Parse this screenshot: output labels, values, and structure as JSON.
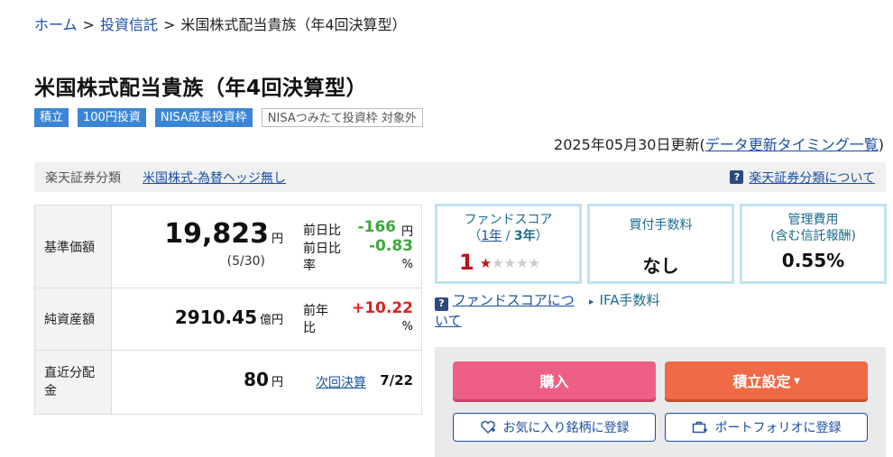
{
  "breadcrumb": {
    "home": "ホーム",
    "sep": ">",
    "funds": "投資信託",
    "current": "米国株式配当貴族（年4回決算型）"
  },
  "title": "米国株式配当貴族（年4回決算型）",
  "tags": {
    "tsumitate": "積立",
    "yen100": "100円投資",
    "nisa_growth": "NISA成長投資枠",
    "nisa_tsumitate": "NISAつみたて投資枠 対象外"
  },
  "updated": {
    "date_text": "2025年05月30日更新",
    "paren_open": "(",
    "link": "データ更新タイミング一覧",
    "paren_close": ")"
  },
  "category": {
    "label": "楽天証券分類",
    "value": "米国株式-為替ヘッジ無し",
    "help_icon": "?",
    "help_link": "楽天証券分類について"
  },
  "nav": {
    "label": "基準価額",
    "value": "19,823",
    "unit": "円",
    "date": "(5/30)",
    "change_label": "前日比",
    "change_value": "-166",
    "change_unit": "円",
    "ratio_label_1": "前日比",
    "ratio_label_2": "率",
    "ratio_value": "-0.83",
    "ratio_unit": "%"
  },
  "assets": {
    "label": "純資産額",
    "value": "2910.45",
    "unit": "億円",
    "yoy_label_1": "前年",
    "yoy_label_2": "比",
    "yoy_value": "+10.22",
    "yoy_unit": "%"
  },
  "dividend": {
    "label_1": "直近分配",
    "label_2": "金",
    "value": "80",
    "unit": "円",
    "next_link": "次回決算",
    "next_date": "7/22"
  },
  "score": {
    "title": "ファンドスコア",
    "paren_open": "（",
    "period_1y": "1年",
    "slash": " / ",
    "period_3y": "3年",
    "paren_close": "）",
    "value": "1",
    "stars_on": 1,
    "stars_total": 5
  },
  "purchase_fee": {
    "title": "買付手数料",
    "value": "なし"
  },
  "management_fee": {
    "title_1": "管理費用",
    "title_2": "(含む信託報酬)",
    "value": "0.55%"
  },
  "score_links": {
    "help_icon": "?",
    "score_help_1": "ファンドスコアにつ",
    "score_help_2": "いて",
    "ifa_arrow": "▸",
    "ifa_fee": "IFA手数料"
  },
  "actions": {
    "buy": "購入",
    "tsumitate": "積立設定",
    "tsumitate_arrow": "▾",
    "favorite": "お気に入り銘柄に登録",
    "portfolio": "ポートフォリオに登録"
  },
  "colors": {
    "link": "#1a4fa3",
    "tag_blue": "#3a86d4",
    "positive": "#e02020",
    "negative": "#3ca83c",
    "buy": "#ee5f86",
    "tsumitate": "#ee6b45",
    "score_border": "#bfe3ef"
  }
}
